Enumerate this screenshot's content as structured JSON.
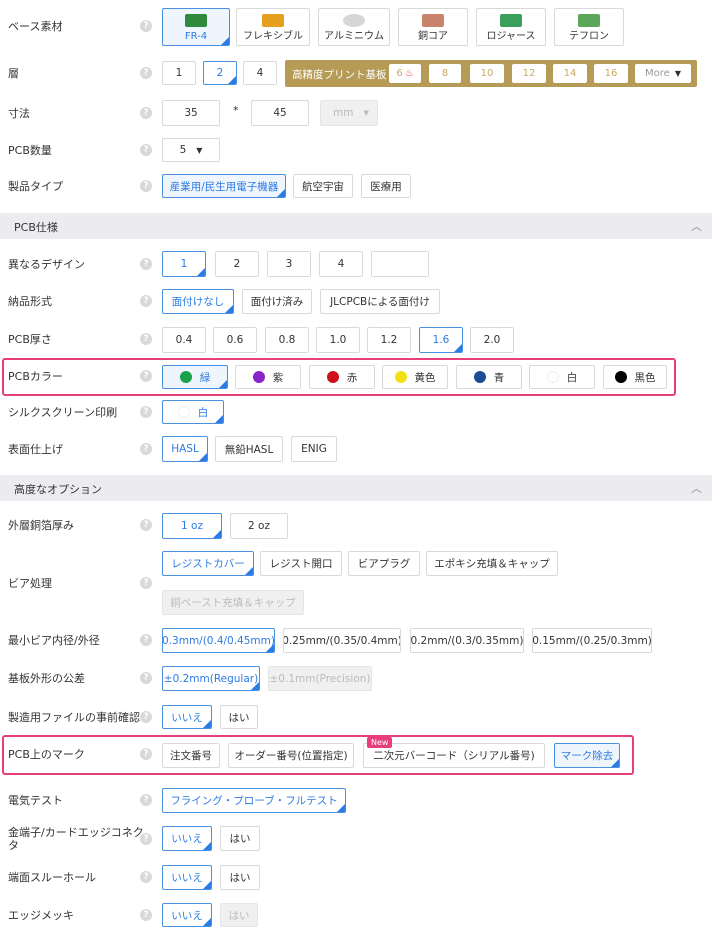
{
  "materials": [
    "FR-4",
    "フレキシブル",
    "アルミニウム",
    "銅コア",
    "ロジャース",
    "テフロン"
  ],
  "layers": {
    "label": "層",
    "opts": [
      "1",
      "2",
      "4"
    ],
    "hp_label": "高精度プリント基板",
    "hp_opts": [
      "6",
      "8",
      "10",
      "12",
      "14",
      "16"
    ],
    "more": "More"
  },
  "dim": {
    "label": "寸法",
    "w": "35",
    "sep": "*",
    "h": "45",
    "unit": "mm"
  },
  "qty": {
    "label": "PCB数量",
    "value": "5"
  },
  "ptype": {
    "label": "製品タイプ",
    "opts": [
      "産業用/民生用電子機器",
      "航空宇宙",
      "医療用"
    ]
  },
  "base_label": "ベース素材",
  "s1": "PCB仕様",
  "diff": {
    "label": "異なるデザイン",
    "opts": [
      "1",
      "2",
      "3",
      "4",
      ""
    ]
  },
  "delivery": {
    "label": "納品形式",
    "opts": [
      "面付けなし",
      "面付け済み",
      "JLCPCBによる面付け"
    ]
  },
  "thick": {
    "label": "PCB厚さ",
    "opts": [
      "0.4",
      "0.6",
      "0.8",
      "1.0",
      "1.2",
      "1.6",
      "2.0"
    ]
  },
  "color": {
    "label": "PCBカラー",
    "opts": [
      "緑",
      "紫",
      "赤",
      "黄色",
      "青",
      "白",
      "黒色"
    ],
    "dots": [
      "#1aa14b",
      "#8a24c9",
      "#d0111b",
      "#f3e012",
      "#1a4d96",
      "#ffffff",
      "#000000"
    ]
  },
  "silk": {
    "label": "シルクスクリーン印刷",
    "value": "白"
  },
  "surface": {
    "label": "表面仕上げ",
    "opts": [
      "HASL",
      "無鉛HASL",
      "ENIG"
    ]
  },
  "s2": "高度なオプション",
  "copper": {
    "label": "外層銅箔厚み",
    "opts": [
      "1 oz",
      "2 oz"
    ]
  },
  "via": {
    "label": "ビア処理",
    "opts": [
      "レジストカバー",
      "レジスト開口",
      "ビアプラグ",
      "エポキシ充填＆キャップ",
      "銅ペースト充填＆キャップ"
    ]
  },
  "minvia": {
    "label": "最小ビア内径/外径",
    "opts": [
      "0.3mm/(0.4/0.45mm)",
      "0.25mm/(0.35/0.4mm)",
      "0.2mm/(0.3/0.35mm)",
      "0.15mm/(0.25/0.3mm)"
    ]
  },
  "tol": {
    "label": "基板外形の公差",
    "opts": [
      "±0.2mm(Regular)",
      "±0.1mm(Precision)"
    ]
  },
  "confirm": {
    "label": "製造用ファイルの事前確認",
    "opts": [
      "いいえ",
      "はい"
    ]
  },
  "mark": {
    "label": "PCB上のマーク",
    "opts": [
      "注文番号",
      "オーダー番号(位置指定)",
      "二次元バーコード（シリアル番号)",
      "マーク除去"
    ],
    "new": "New"
  },
  "etest": {
    "label": "電気テスト",
    "value": "フライング・プローブ・フルテスト"
  },
  "gold": {
    "label1": "金端子/カードエッジコネク",
    "label2": "タ",
    "opts": [
      "いいえ",
      "はい"
    ]
  },
  "edge": {
    "label": "端面スルーホール",
    "opts": [
      "いいえ",
      "はい"
    ]
  },
  "plate": {
    "label": "エッジメッキ",
    "opts": [
      "いいえ",
      "はい"
    ]
  }
}
